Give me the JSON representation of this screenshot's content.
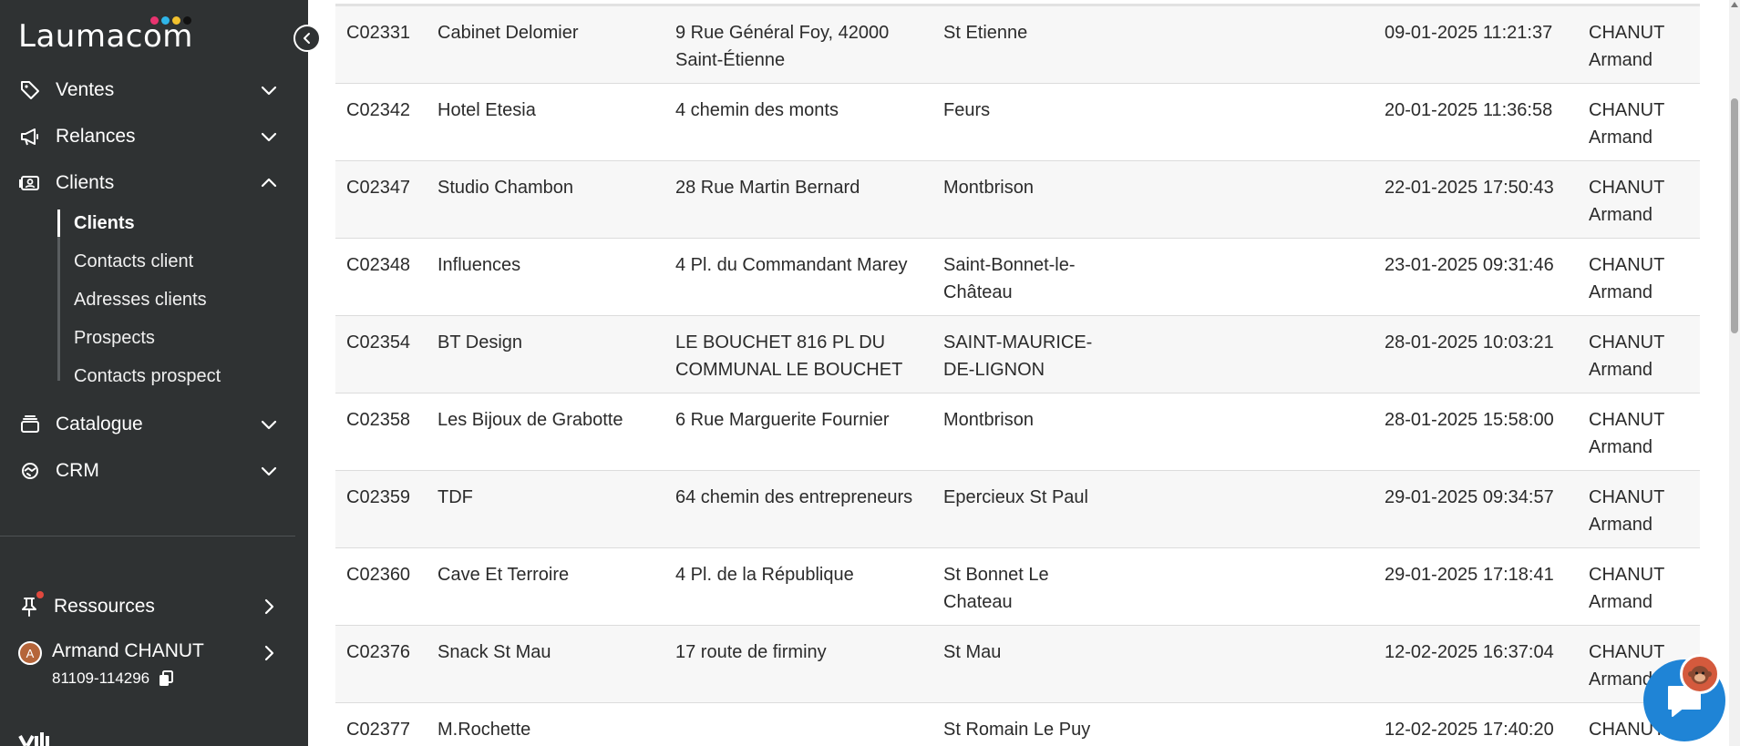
{
  "brand": {
    "name": "Laumacom",
    "dot_colors": [
      "#e8336f",
      "#2fb5e8",
      "#f2c12e",
      "#111111"
    ]
  },
  "sidebar": {
    "nav": [
      {
        "label": "Ventes",
        "icon": "tag-icon",
        "state": "collapsed"
      },
      {
        "label": "Relances",
        "icon": "megaphone-icon",
        "state": "collapsed"
      },
      {
        "label": "Clients",
        "icon": "contact-card-icon",
        "state": "expanded"
      }
    ],
    "clients_sub": [
      {
        "label": "Clients",
        "active": true
      },
      {
        "label": "Contacts client",
        "active": false
      },
      {
        "label": "Adresses clients",
        "active": false
      },
      {
        "label": "Prospects",
        "active": false
      },
      {
        "label": "Contacts prospect",
        "active": false
      }
    ],
    "nav_after": [
      {
        "label": "Catalogue",
        "icon": "stack-icon",
        "state": "collapsed"
      },
      {
        "label": "CRM",
        "icon": "handshake-icon",
        "state": "collapsed"
      }
    ],
    "resources": {
      "label": "Ressources",
      "icon": "pin-icon",
      "notification": true
    },
    "user": {
      "initial": "A",
      "name": "Armand CHANUT",
      "id": "81109-114296"
    }
  },
  "table": {
    "rows": [
      {
        "code": "C02331",
        "name": "Cabinet Delomier",
        "address": "9 Rue Général Foy, 42000 Saint-Étienne",
        "city": "St Etienne",
        "date": "09-01-2025 11:21:37",
        "owner": "CHANUT Armand"
      },
      {
        "code": "C02342",
        "name": "Hotel Etesia",
        "address": "4 chemin des monts",
        "city": "Feurs",
        "date": "20-01-2025 11:36:58",
        "owner": "CHANUT Armand"
      },
      {
        "code": "C02347",
        "name": "Studio Chambon",
        "address": "28 Rue Martin Bernard",
        "city": "Montbrison",
        "date": "22-01-2025 17:50:43",
        "owner": "CHANUT Armand"
      },
      {
        "code": "C02348",
        "name": "Influences",
        "address": "4 Pl. du Commandant Marey",
        "city": "Saint-Bonnet-le-Château",
        "date": "23-01-2025 09:31:46",
        "owner": "CHANUT Armand"
      },
      {
        "code": "C02354",
        "name": "BT Design",
        "address": "LE BOUCHET 816 PL DU COMMUNAL LE BOUCHET",
        "city": "SAINT-MAURICE-DE-LIGNON",
        "date": "28-01-2025 10:03:21",
        "owner": "CHANUT Armand"
      },
      {
        "code": "C02358",
        "name": "Les Bijoux de Grabotte",
        "address": "6 Rue Marguerite Fournier",
        "city": "Montbrison",
        "date": "28-01-2025 15:58:00",
        "owner": "CHANUT Armand"
      },
      {
        "code": "C02359",
        "name": "TDF",
        "address": "64 chemin des entrepreneurs",
        "city": "Epercieux St Paul",
        "date": "29-01-2025 09:34:57",
        "owner": "CHANUT Armand"
      },
      {
        "code": "C02360",
        "name": "Cave Et Terroire",
        "address": "4 Pl. de la République",
        "city": "St Bonnet Le Chateau",
        "date": "29-01-2025 17:18:41",
        "owner": "CHANUT Armand"
      },
      {
        "code": "C02376",
        "name": "Snack St Mau",
        "address": "17 route de firminy",
        "city": "St Mau",
        "date": "12-02-2025 16:37:04",
        "owner": "CHANUT Armand"
      },
      {
        "code": "C02377",
        "name": "M.Rochette",
        "address": "",
        "city": "St Romain Le Puy",
        "date": "12-02-2025 17:40:20",
        "owner": "CHANUT Armand"
      }
    ]
  },
  "chat_widget": {
    "icon": "chat-bubble-icon",
    "color": "#1f84d6"
  }
}
